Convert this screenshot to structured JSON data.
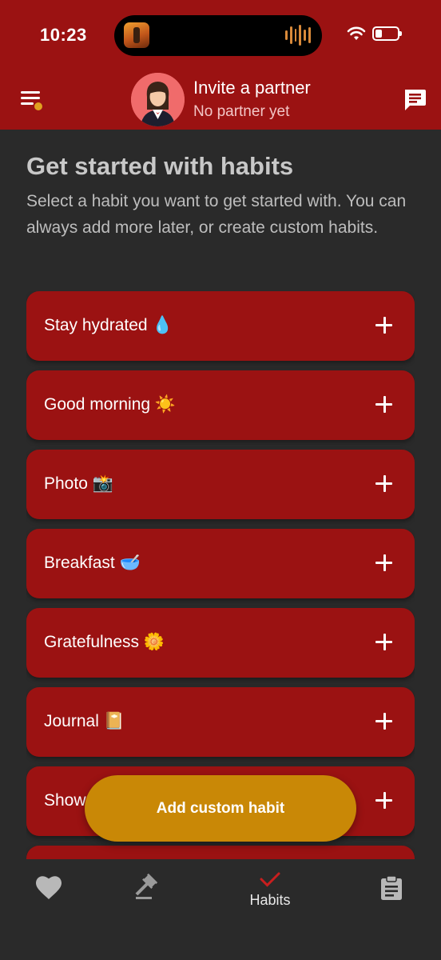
{
  "status_bar": {
    "time": "10:23"
  },
  "header": {
    "partner_title": "Invite a partner",
    "partner_subtitle": "No partner yet",
    "colors": {
      "background": "#9b1212",
      "notification_dot": "#e0a020"
    }
  },
  "content": {
    "heading": "Get started with habits",
    "intro": "Select a habit you want to get started with. You can always add more later, or create custom habits."
  },
  "habits": [
    {
      "label": "Stay hydrated 💧"
    },
    {
      "label": "Good morning ☀️"
    },
    {
      "label": "Photo 📸"
    },
    {
      "label": "Breakfast 🥣"
    },
    {
      "label": "Gratefulness 🌼"
    },
    {
      "label": "Journal 📔"
    },
    {
      "label": "Show"
    },
    {
      "label": ""
    }
  ],
  "fab": {
    "label": "Add custom habit",
    "color": "#c98806"
  },
  "bottom_nav": {
    "items": [
      {
        "icon": "heart-icon",
        "label": ""
      },
      {
        "icon": "gavel-icon",
        "label": ""
      },
      {
        "icon": "check-icon",
        "label": "Habits",
        "active": true
      },
      {
        "icon": "clipboard-icon",
        "label": ""
      }
    ],
    "active_color": "#c81e1e"
  }
}
